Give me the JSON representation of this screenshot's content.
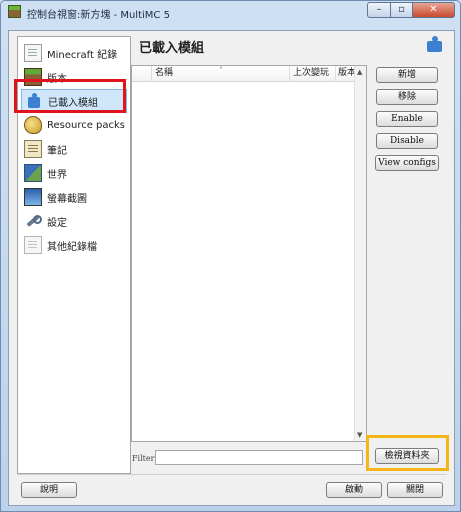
{
  "window": {
    "title": "控制台視窗:新方塊 - MultiMC 5",
    "minimize_glyph": "–",
    "maximize_glyph": "▫",
    "close_glyph": "✕",
    "app_icon": "grass-block-icon"
  },
  "sidebar": {
    "items": [
      {
        "label": "Minecraft 紀錄",
        "icon": "document-icon"
      },
      {
        "label": "版本",
        "icon": "grass-block-icon"
      },
      {
        "label": "已載入模組",
        "icon": "puzzle-icon"
      },
      {
        "label": "Resource packs",
        "icon": "palette-icon"
      },
      {
        "label": "筆記",
        "icon": "notes-icon"
      },
      {
        "label": "世界",
        "icon": "world-icon"
      },
      {
        "label": "螢幕截圖",
        "icon": "screenshot-icon"
      },
      {
        "label": "設定",
        "icon": "settings-icon"
      },
      {
        "label": "其他紀錄檔",
        "icon": "log-file-icon"
      }
    ],
    "selected_index": 2
  },
  "page": {
    "title": "已載入模組",
    "icon": "puzzle-icon"
  },
  "table": {
    "columns": [
      "",
      "名稱",
      "上次變玩",
      "版本"
    ],
    "sort_indicator": "˄",
    "rows": [],
    "scroll_up": "▲",
    "scroll_down": "▼"
  },
  "actions": {
    "add": "新增",
    "remove": "移除",
    "enable": "Enable",
    "disable": "Disable",
    "view_configs": "View configs",
    "view_folder": "檢視資料夾"
  },
  "filter": {
    "label": "Filter:",
    "value": ""
  },
  "footer": {
    "help": "說明",
    "launch": "啟動",
    "close": "關閉"
  },
  "colors": {
    "highlight_red": "#e0141e",
    "highlight_yellow": "#f5b417",
    "selected_bg": "#cfe6fb"
  }
}
